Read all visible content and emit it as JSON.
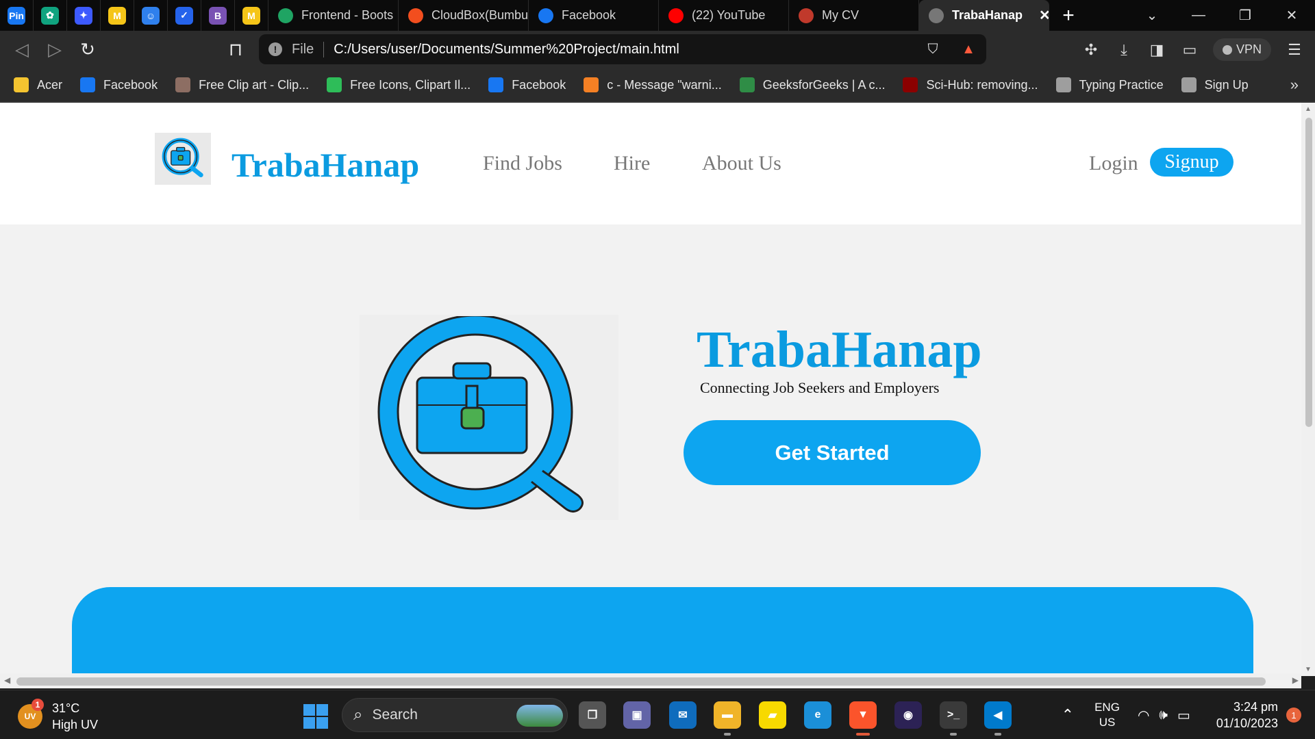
{
  "browser": {
    "pinned_tabs": [
      {
        "icon": "pinterest-icon",
        "glyph": "Pin",
        "color": "#1877f2"
      },
      {
        "icon": "chatgpt-icon",
        "glyph": "✿",
        "color": "#10a37f"
      },
      {
        "icon": "sparkle-icon",
        "glyph": "✦",
        "color": "#3d5afe"
      },
      {
        "icon": "miro-icon",
        "glyph": "M",
        "color": "#f5c518"
      },
      {
        "icon": "bot-icon",
        "glyph": "☺",
        "color": "#2f80ed"
      },
      {
        "icon": "todo-check-icon",
        "glyph": "✓",
        "color": "#2563eb"
      },
      {
        "icon": "bootstrap-icon",
        "glyph": "B",
        "color": "#7952b3"
      },
      {
        "icon": "miro-icon",
        "glyph": "M",
        "color": "#f5c518"
      }
    ],
    "tabs": [
      {
        "title": "Frontend - Boots",
        "icon": "google-drive-icon",
        "color": "#1fa463"
      },
      {
        "title": "CloudBox(Bumbu",
        "icon": "figma-icon",
        "color": "#f24e1e"
      },
      {
        "title": "Facebook",
        "icon": "facebook-icon",
        "color": "#1877f2"
      },
      {
        "title": "(22) YouTube",
        "icon": "youtube-icon",
        "color": "#ff0000"
      },
      {
        "title": "My CV",
        "icon": "cv-icon",
        "color": "#c0392b"
      },
      {
        "title": "TrabaHanap",
        "icon": "globe-icon",
        "color": "#777777",
        "active": true
      }
    ],
    "url_scheme": "File",
    "url": "C:/Users/user/Documents/Summer%20Project/main.html",
    "vpn_label": "VPN",
    "bookmarks": [
      {
        "label": "Acer",
        "icon": "folder-icon",
        "color": "#f4c430"
      },
      {
        "label": "Facebook",
        "icon": "facebook-icon",
        "color": "#1877f2"
      },
      {
        "label": "Free Clip art - Clip...",
        "icon": "clipart-icon",
        "color": "#8d6e63"
      },
      {
        "label": "Free Icons, Clipart Il...",
        "icon": "icons-site-icon",
        "color": "#2ebd59"
      },
      {
        "label": "Facebook",
        "icon": "facebook-icon",
        "color": "#1877f2"
      },
      {
        "label": "c - Message \"warni...",
        "icon": "stackoverflow-icon",
        "color": "#f48024"
      },
      {
        "label": "GeeksforGeeks | A c...",
        "icon": "geeksforgeeks-icon",
        "color": "#2f8d46"
      },
      {
        "label": "Sci-Hub: removing...",
        "icon": "scihub-icon",
        "color": "#8b0000"
      },
      {
        "label": "Typing Practice",
        "icon": "typing-icon",
        "color": "#9e9e9e"
      },
      {
        "label": "Sign Up",
        "icon": "signup-dots-icon",
        "color": "#9e9e9e"
      }
    ]
  },
  "site": {
    "brand": "TrabaHanap",
    "nav": [
      "Find Jobs",
      "Hire",
      "About Us"
    ],
    "login": "Login",
    "signup": "Signup",
    "hero": {
      "title": "TrabaHanap",
      "subtitle": "Connecting Job Seekers and Employers",
      "cta": "Get Started"
    },
    "colors": {
      "accent": "#0da5f0",
      "brand_text": "#0b9be0",
      "nav_text": "#777777",
      "briefcase_clasp": "#4caf50"
    }
  },
  "taskbar": {
    "weather_temp": "31°C",
    "weather_desc": "High UV",
    "uv_label": "UV",
    "uv_badge": "1",
    "search_placeholder": "Search",
    "apps": [
      {
        "icon": "task-view-icon",
        "glyph": "❐",
        "color": "#555555"
      },
      {
        "icon": "teams-chat-icon",
        "glyph": "▣",
        "color": "#6264a7"
      },
      {
        "icon": "mail-icon",
        "glyph": "✉",
        "color": "#0f6cbd"
      },
      {
        "icon": "file-explorer-icon",
        "glyph": "▬",
        "color": "#f0b429"
      },
      {
        "icon": "sticky-notes-icon",
        "glyph": "▰",
        "color": "#f7d900"
      },
      {
        "icon": "edge-icon",
        "glyph": "e",
        "color": "#1b8fd8"
      },
      {
        "icon": "brave-icon",
        "glyph": "▼",
        "color": "#fb542b"
      },
      {
        "icon": "eclipse-icon",
        "glyph": "◉",
        "color": "#2c2255"
      },
      {
        "icon": "terminal-icon",
        "glyph": ">_",
        "color": "#3a3a3a"
      },
      {
        "icon": "vscode-icon",
        "glyph": "◀",
        "color": "#007acc"
      }
    ],
    "lang_top": "ENG",
    "lang_bottom": "US",
    "time": "3:24 pm",
    "date": "01/10/2023",
    "notification_count": "1"
  }
}
